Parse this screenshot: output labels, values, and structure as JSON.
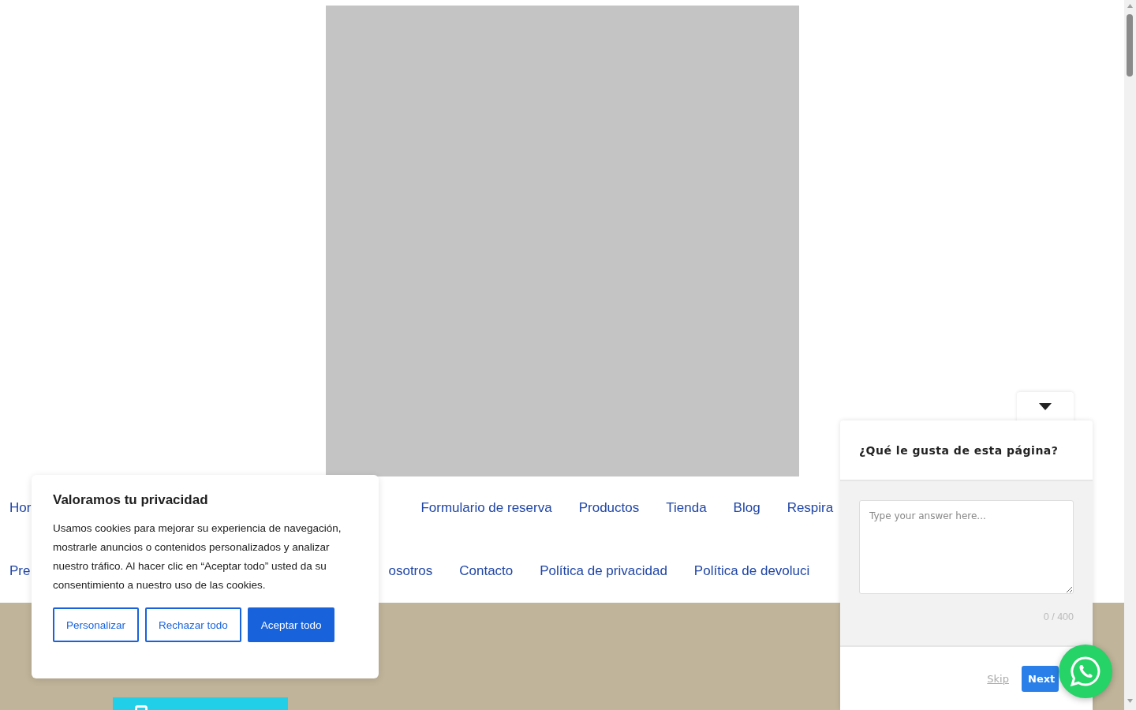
{
  "nav": {
    "rows": [
      {
        "lead": "Hor",
        "items": [
          "Formulario de reserva",
          "Productos",
          "Tienda",
          "Blog",
          "Respira"
        ]
      },
      {
        "lead": "Pre",
        "items": [
          "osotros",
          "Contacto",
          "Política de privacidad",
          "Política de devoluci"
        ]
      }
    ]
  },
  "cookie_banner": {
    "title": "Valoramos tu privacidad",
    "text": "Usamos cookies para mejorar su experiencia de navegación, mostrarle anuncios o contenidos personalizados y analizar nuestro tráfico. Al hacer clic en “Aceptar todo” usted da su consentimiento a nuestro uso de las cookies.",
    "buttons": [
      {
        "label": "Personalizar",
        "kind": "outline"
      },
      {
        "label": "Rechazar todo",
        "kind": "outline"
      },
      {
        "label": "Aceptar todo",
        "kind": "primary"
      }
    ]
  },
  "survey": {
    "question": "¿Qué le gusta de esta página?",
    "answer": {
      "placeholder": "Type your answer here..."
    },
    "counter": "0 / 400",
    "skip": "Skip",
    "next": "Next"
  }
}
